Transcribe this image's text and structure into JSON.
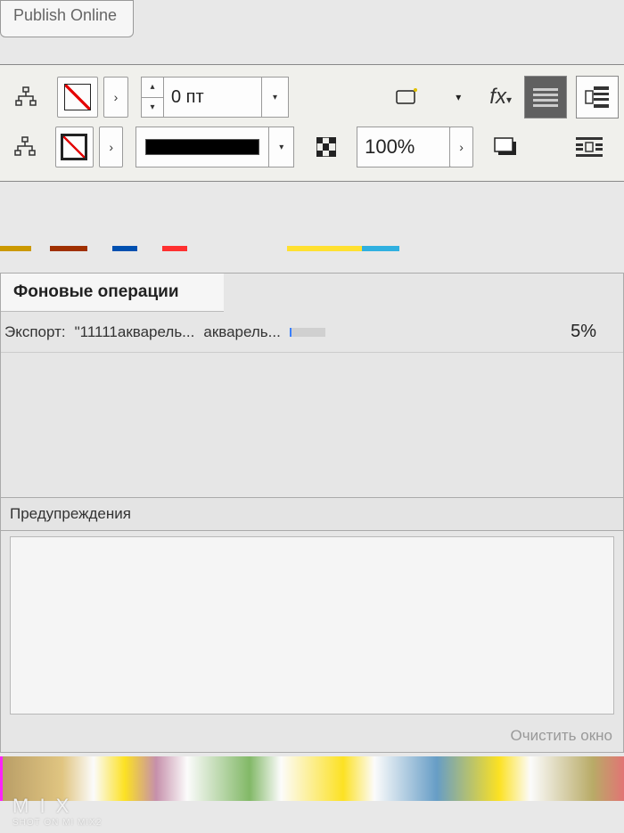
{
  "top_tab": {
    "label": "Publish Online"
  },
  "toolbar": {
    "stroke_value": "0 пт",
    "opacity_value": "100%",
    "fx_label": "fx"
  },
  "panel": {
    "title": "Фоновые операции",
    "task": {
      "prefix": "Экспорт:",
      "name": "\"11111акварель...",
      "name2": "акварель...",
      "percent": "5%"
    },
    "warnings_title": "Предупреждения",
    "clear_label": "Очистить окно"
  },
  "watermark": {
    "line1": "M I X",
    "line2": "SHOT ON MI MIX2"
  }
}
